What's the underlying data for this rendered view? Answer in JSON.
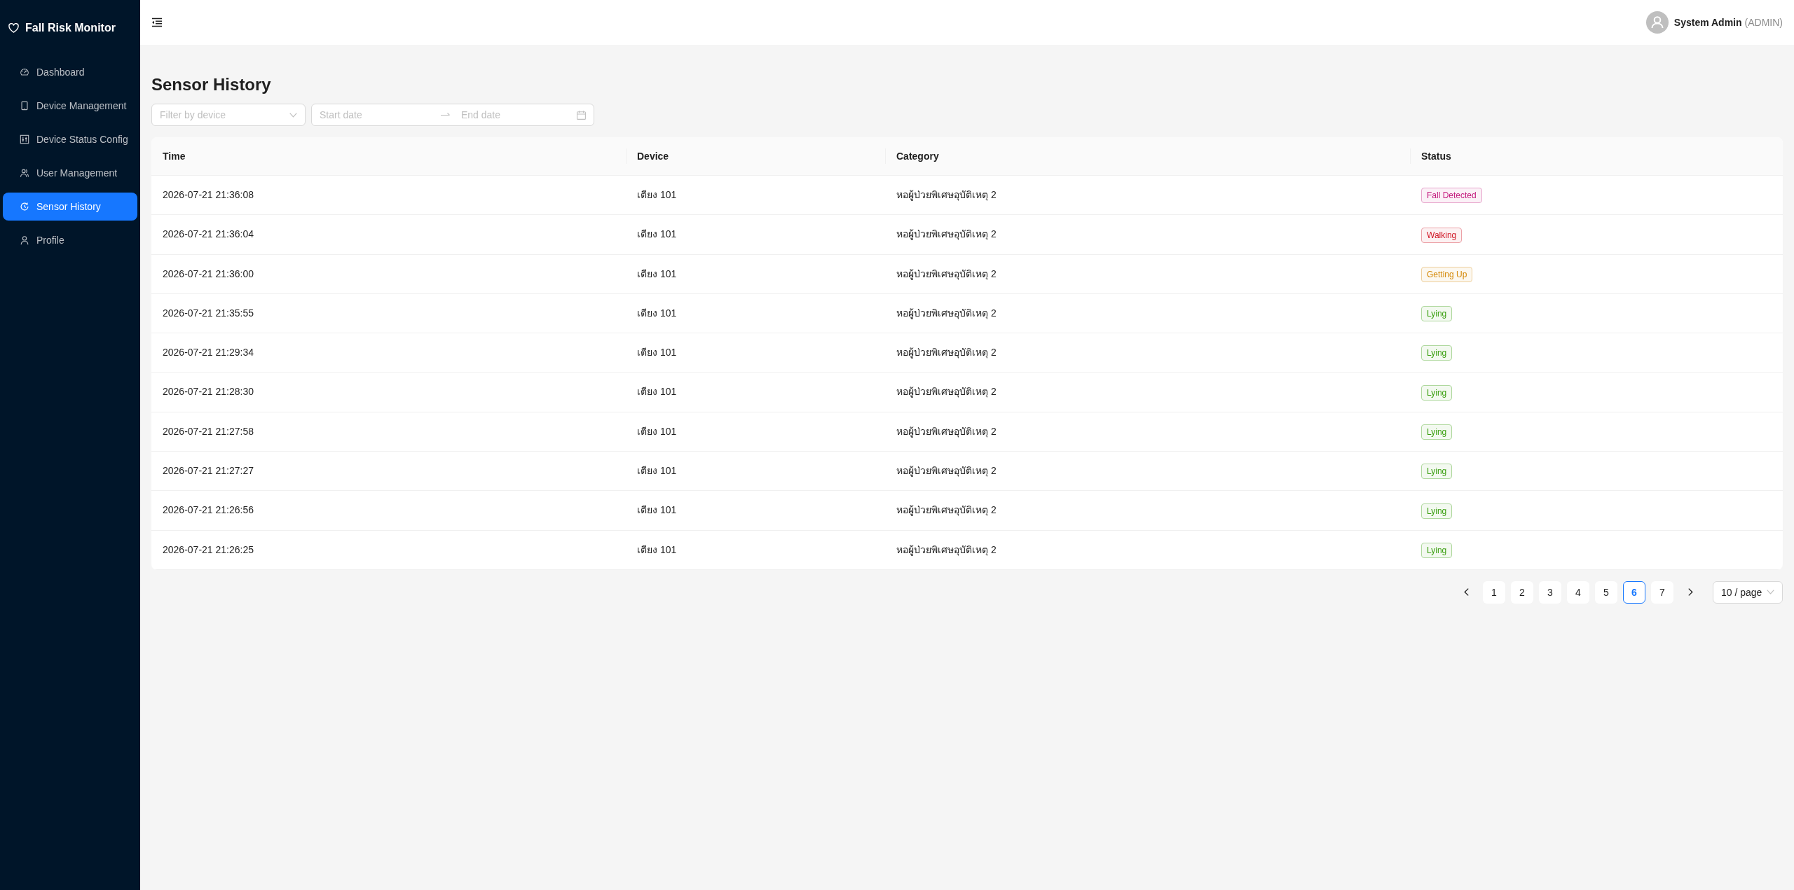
{
  "sidebar": {
    "logo": "Fall Risk Monitor",
    "items": [
      {
        "label": "Dashboard",
        "selected": false
      },
      {
        "label": "Device Management",
        "selected": false
      },
      {
        "label": "Device Status Config",
        "selected": false
      },
      {
        "label": "User Management",
        "selected": false
      },
      {
        "label": "Sensor History",
        "selected": true
      },
      {
        "label": "Profile",
        "selected": false
      }
    ]
  },
  "header": {
    "user_name": "System Admin",
    "user_role": "(ADMIN)"
  },
  "page_title": "Sensor History",
  "filters": {
    "device": {
      "placeholder": "Filter by device"
    },
    "date_range": {
      "start": {
        "placeholder": "Start date"
      },
      "end": {
        "placeholder": "End date"
      }
    }
  },
  "table": {
    "columns": [
      "Time",
      "Device",
      "Category",
      "Status"
    ],
    "rows": [
      {
        "time": "2026-07-21 21:36:08",
        "device": "เตียง 101",
        "category": "หอผู้ป่วยพิเศษอุบัติเหตุ 2",
        "status": {
          "label": "Fall Detected",
          "color": "#c41d7f"
        }
      },
      {
        "time": "2026-07-21 21:36:04",
        "device": "เตียง 101",
        "category": "หอผู้ป่วยพิเศษอุบัติเหตุ 2",
        "status": {
          "label": "Walking",
          "color": "#cf1322"
        }
      },
      {
        "time": "2026-07-21 21:36:00",
        "device": "เตียง 101",
        "category": "หอผู้ป่วยพิเศษอุบัติเหตุ 2",
        "status": {
          "label": "Getting Up",
          "color": "#d48806"
        }
      },
      {
        "time": "2026-07-21 21:35:55",
        "device": "เตียง 101",
        "category": "หอผู้ป่วยพิเศษอุบัติเหตุ 2",
        "status": {
          "label": "Lying",
          "color": "#389e0d"
        }
      },
      {
        "time": "2026-07-21 21:29:34",
        "device": "เตียง 101",
        "category": "หอผู้ป่วยพิเศษอุบัติเหตุ 2",
        "status": {
          "label": "Lying",
          "color": "#389e0d"
        }
      },
      {
        "time": "2026-07-21 21:28:30",
        "device": "เตียง 101",
        "category": "หอผู้ป่วยพิเศษอุบัติเหตุ 2",
        "status": {
          "label": "Lying",
          "color": "#389e0d"
        }
      },
      {
        "time": "2026-07-21 21:27:58",
        "device": "เตียง 101",
        "category": "หอผู้ป่วยพิเศษอุบัติเหตุ 2",
        "status": {
          "label": "Lying",
          "color": "#389e0d"
        }
      },
      {
        "time": "2026-07-21 21:27:27",
        "device": "เตียง 101",
        "category": "หอผู้ป่วยพิเศษอุบัติเหตุ 2",
        "status": {
          "label": "Lying",
          "color": "#389e0d"
        }
      },
      {
        "time": "2026-07-21 21:26:56",
        "device": "เตียง 101",
        "category": "หอผู้ป่วยพิเศษอุบัติเหตุ 2",
        "status": {
          "label": "Lying",
          "color": "#389e0d"
        }
      },
      {
        "time": "2026-07-21 21:26:25",
        "device": "เตียง 101",
        "category": "หอผู้ป่วยพิเศษอุบัติเหตุ 2",
        "status": {
          "label": "Lying",
          "color": "#389e0d"
        }
      }
    ]
  },
  "pagination": {
    "pages": [
      {
        "label": "1",
        "selected": false
      },
      {
        "label": "2",
        "selected": false
      },
      {
        "label": "3",
        "selected": false
      },
      {
        "label": "4",
        "selected": false
      },
      {
        "label": "5",
        "selected": false
      },
      {
        "label": "6",
        "selected": true
      },
      {
        "label": "7",
        "selected": false
      }
    ],
    "page_size": "10 / page"
  }
}
